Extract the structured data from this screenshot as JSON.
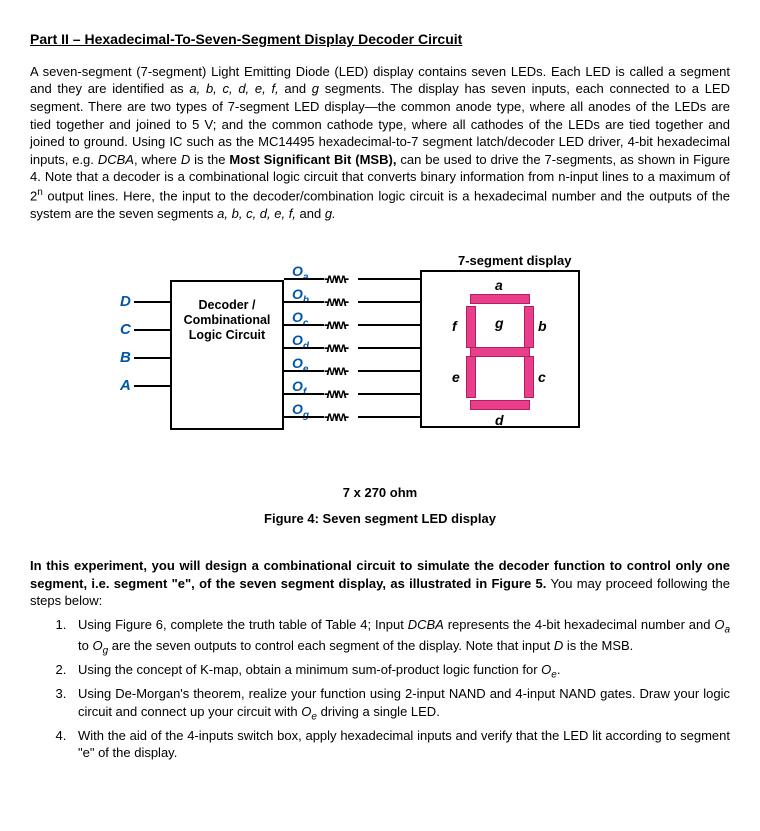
{
  "title": "Part II – Hexadecimal-To-Seven-Segment Display Decoder Circuit",
  "para1_a": "A seven-segment (7-segment) Light Emitting Diode (LED) display contains seven LEDs. Each LED is called a segment and they are identified as ",
  "seg_list": "a, b, c, d, e, f,",
  "para1_b": " and ",
  "seg_g": "g",
  "para1_c": " segments. The display has seven inputs, each connected to a LED segment. There are two types of 7-segment LED display—the common anode type, where all anodes of the LEDs are tied together and joined to 5 V; and the common cathode type, where all cathodes of the LEDs are tied together and joined to ground. Using IC such as the MC14495 hexadecimal-to-7 segment latch/decoder LED driver, 4-bit hexadecimal inputs, e.g. ",
  "dcba": "DCBA",
  "para1_d": ", where ",
  "D": "D",
  "para1_e": " is the ",
  "msb": "Most Significant Bit (MSB),",
  "para1_f": " can be used to drive the 7-segments, as shown in Figure 4. Note that a decoder is a combinational logic circuit that converts binary information from n-input lines to a maximum of 2",
  "n": "n",
  "para1_g": " output lines. Here, the input to the decoder/combination logic circuit is a hexadecimal number and the outputs of the system are the seven segments ",
  "seg_list2": "a, b, c, d, e, f,",
  "para1_h": " and ",
  "seg_g2": "g.",
  "figure": {
    "display_title": "7-segment display",
    "inputs": [
      "D",
      "C",
      "B",
      "A"
    ],
    "decoder_l1": "Decoder /",
    "decoder_l2": "Combinational",
    "decoder_l3": "Logic Circuit",
    "outputs": [
      "a",
      "b",
      "c",
      "d",
      "e",
      "f",
      "g"
    ],
    "seg_labels": {
      "a": "a",
      "b": "b",
      "c": "c",
      "d": "d",
      "e": "e",
      "f": "f",
      "g": "g"
    },
    "resistor_caption": "7 x 270 ohm",
    "caption": "Figure 4: Seven segment LED display"
  },
  "para2_a": "In this experiment, you will design a combinational circuit to simulate the decoder function to control only one segment, i.e. segment \"e\", of the seven segment display, as illustrated in Figure 5.",
  "para2_b": " You may proceed following the steps below:",
  "steps": {
    "s1_a": "Using Figure 6, complete the truth table of Table 4; Input ",
    "s1_dcba": "DCBA",
    "s1_b": " represents the 4-bit hexadecimal number and ",
    "s1_oa": "O",
    "s1_oa_sub": "a",
    "s1_c": " to ",
    "s1_og": "O",
    "s1_og_sub": "g",
    "s1_d": " are the seven outputs to control each segment of the display. Note that input ",
    "s1_D": "D",
    "s1_e": " is the MSB.",
    "s2_a": "Using the concept of K-map, obtain a minimum sum-of-product logic function for ",
    "s2_oe": "O",
    "s2_oe_sub": "e",
    "s2_b": ".",
    "s3_a": "Using De-Morgan's theorem, realize your function using 2-input NAND and 4-input NAND gates. Draw your logic circuit and connect up your circuit with ",
    "s3_oe": "O",
    "s3_oe_sub": "e",
    "s3_b": " driving a single LED.",
    "s4": "With the aid of the 4-inputs switch box, apply hexadecimal inputs and verify that the LED lit according to segment \"e\" of the display."
  }
}
